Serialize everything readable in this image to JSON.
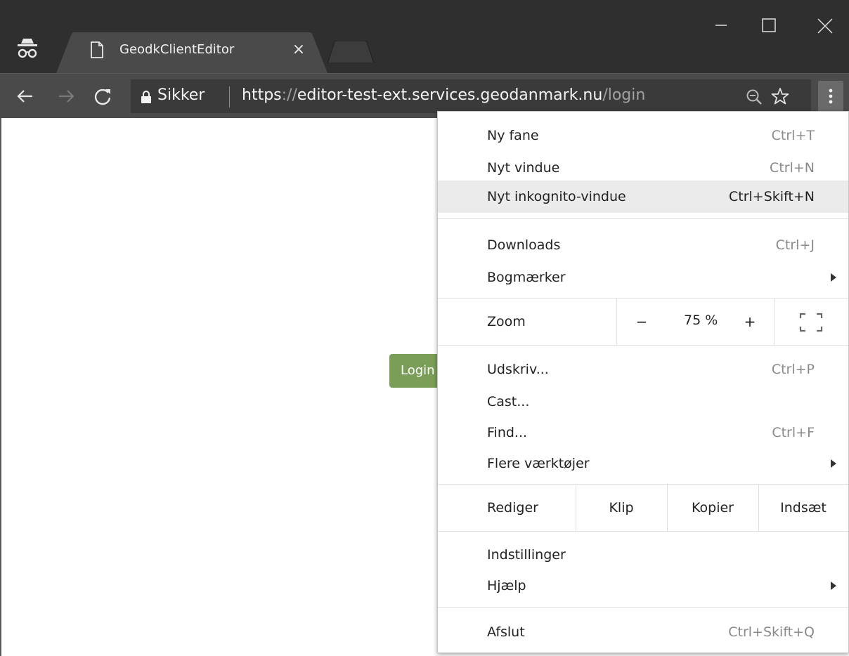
{
  "browser": {
    "tab": {
      "title": "GeodkClientEditor",
      "close": "×"
    },
    "omnibox": {
      "secure_label": "Sikker",
      "url_scheme": "https",
      "url_sep": "://",
      "url_host": "editor-test-ext.services.geodanmark.nu",
      "url_path": "/login"
    }
  },
  "page": {
    "login_label": "Login"
  },
  "menu": {
    "group1": [
      {
        "label": "Ny fane",
        "shortcut": "Ctrl+T"
      },
      {
        "label": "Nyt vindue",
        "shortcut": "Ctrl+N"
      },
      {
        "label": "Nyt inkognito-vindue",
        "shortcut": "Ctrl+Skift+N"
      }
    ],
    "group2": [
      {
        "label": "Downloads",
        "shortcut": "Ctrl+J"
      },
      {
        "label": "Bogmærker"
      }
    ],
    "zoom": {
      "label": "Zoom",
      "minus": "−",
      "value": "75 %",
      "plus": "+"
    },
    "group3": [
      {
        "label": "Udskriv...",
        "shortcut": "Ctrl+P"
      },
      {
        "label": "Cast..."
      },
      {
        "label": "Find...",
        "shortcut": "Ctrl+F"
      },
      {
        "label": "Flere værktøjer"
      }
    ],
    "edit": {
      "label": "Rediger",
      "cut": "Klip",
      "copy": "Kopier",
      "paste": "Indsæt"
    },
    "group4": [
      {
        "label": "Indstillinger"
      },
      {
        "label": "Hjælp"
      }
    ],
    "exit": {
      "label": "Afslut",
      "shortcut": "Ctrl+Skift+Q"
    }
  },
  "icons": {
    "incognito": "incognito-icon",
    "page": "page-icon",
    "back": "arrow-left-icon",
    "forward": "arrow-right-icon",
    "reload": "reload-icon",
    "lock": "lock-icon",
    "zoom": "zoom-out-icon",
    "star": "star-icon",
    "menu": "vertical-dots-icon",
    "submenu": "triangle-right-icon",
    "fullscreen": "fullscreen-icon"
  },
  "colors": {
    "chrome_dark": "#2f2f2f",
    "toolbar": "#4a4a4a",
    "login_green": "#7a9e58",
    "menu_hover": "#ebebeb"
  }
}
